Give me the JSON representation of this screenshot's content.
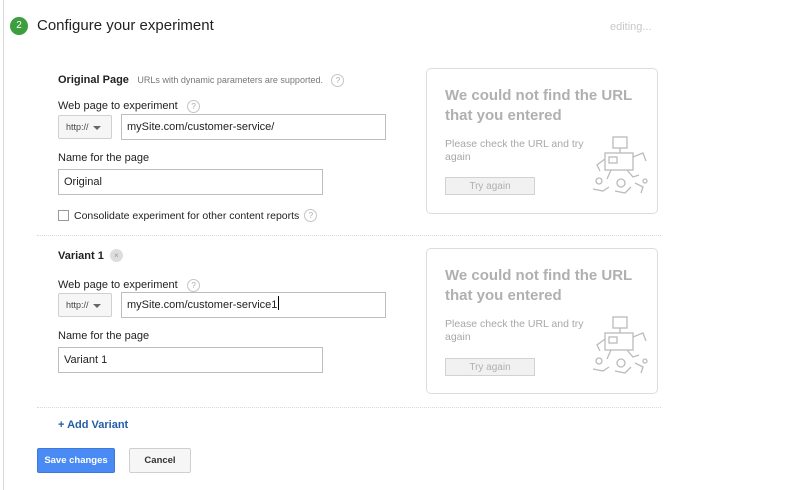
{
  "step": {
    "number": "2",
    "title": "Configure your experiment",
    "status": "editing..."
  },
  "original": {
    "title": "Original Page",
    "note": "URLs with dynamic parameters are supported.",
    "url_label": "Web page to experiment",
    "protocol": "http://",
    "url": "mySite.com/customer-service/",
    "name_label": "Name for the page",
    "name": "Original",
    "consolidate_label": "Consolidate experiment for other content reports",
    "consolidate_checked": false
  },
  "variant": {
    "title": "Variant 1",
    "url_label": "Web page to experiment",
    "protocol": "http://",
    "url": "mySite.com/customer-service1",
    "name_label": "Name for the page",
    "name": "Variant 1"
  },
  "preview": {
    "title": "We could not find the URL that you entered",
    "message": "Please check the URL and try again",
    "button": "Try again"
  },
  "actions": {
    "add_variant": "+ Add Variant",
    "save": "Save changes",
    "cancel": "Cancel"
  },
  "icons": {
    "help": "?",
    "remove": "×"
  },
  "colors": {
    "accent": "#4a8af4",
    "step": "#3c9e3c",
    "link": "#215ea3"
  }
}
